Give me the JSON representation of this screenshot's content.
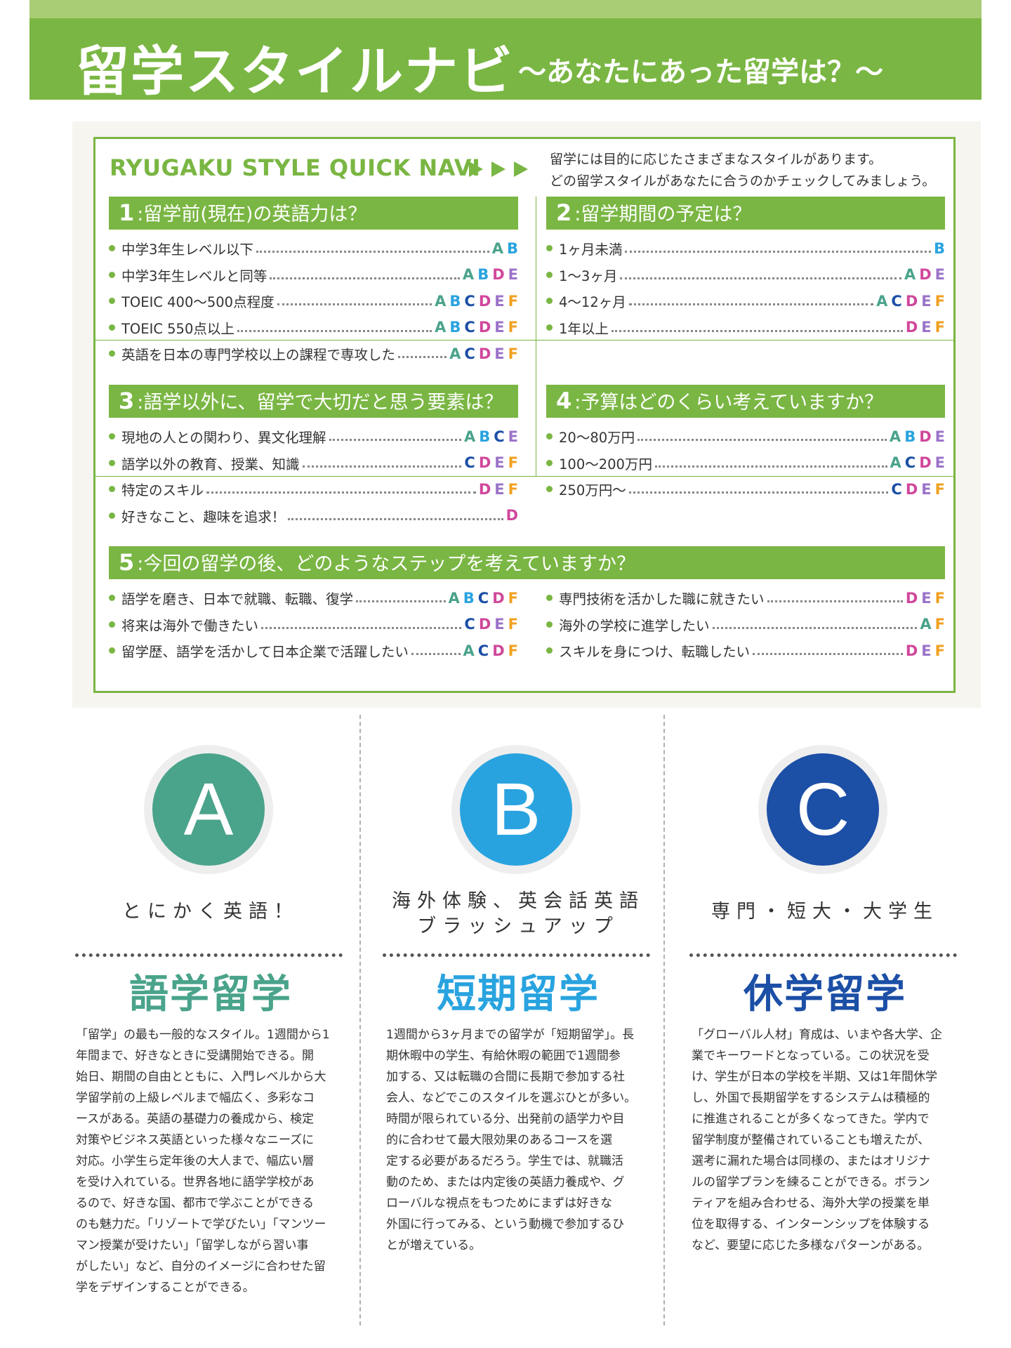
{
  "header": {
    "title": "留学スタイルナビ",
    "subtitle": "〜あなたにあった留学は？〜"
  },
  "navi": {
    "title": "RYUGAKU STYLE QUICK NAVI",
    "desc_line1": "留学には目的に応じたさまざまなスタイルがあります。",
    "desc_line2": "どの留学スタイルがあなたに合うのかチェックしてみましょう。"
  },
  "colors": {
    "brand_green": "#7ab643",
    "A": "#4aa38b",
    "B": "#29a3df",
    "C": "#1c4fa6",
    "D": "#d0479b",
    "E": "#9b73c9",
    "F": "#f0a01f"
  },
  "sections": [
    {
      "num": "1",
      "title": ":留学前(現在)の英語力は？",
      "items": [
        {
          "label": "中学3年生レベル以下",
          "letters": [
            "A",
            "B"
          ]
        },
        {
          "label": "中学3年生レベルと同等",
          "letters": [
            "A",
            "B",
            "D",
            "E"
          ]
        },
        {
          "label": "TOEIC 400〜500点程度",
          "letters": [
            "A",
            "B",
            "C",
            "D",
            "E",
            "F"
          ]
        },
        {
          "label": "TOEIC 550点以上",
          "letters": [
            "A",
            "B",
            "C",
            "D",
            "E",
            "F"
          ]
        },
        {
          "label": "英語を日本の専門学校以上の課程で専攻した",
          "letters": [
            "A",
            "C",
            "D",
            "E",
            "F"
          ]
        }
      ]
    },
    {
      "num": "2",
      "title": ":留学期間の予定は？",
      "items": [
        {
          "label": "1ヶ月未満",
          "letters": [
            "B"
          ]
        },
        {
          "label": "1〜3ヶ月",
          "letters": [
            "A",
            "D",
            "E"
          ]
        },
        {
          "label": "4〜12ヶ月",
          "letters": [
            "A",
            "C",
            "D",
            "E",
            "F"
          ]
        },
        {
          "label": "1年以上",
          "letters": [
            "D",
            "E",
            "F"
          ]
        }
      ]
    },
    {
      "num": "3",
      "title": ":語学以外に、留学で大切だと思う要素は？",
      "items": [
        {
          "label": "現地の人との関わり、異文化理解",
          "letters": [
            "A",
            "B",
            "C",
            "E"
          ]
        },
        {
          "label": "語学以外の教育、授業、知識",
          "letters": [
            "C",
            "D",
            "E",
            "F"
          ]
        },
        {
          "label": "特定のスキル",
          "letters": [
            "D",
            "E",
            "F"
          ]
        },
        {
          "label": "好きなこと、趣味を追求！",
          "letters": [
            "D"
          ]
        }
      ]
    },
    {
      "num": "4",
      "title": ":予算はどのくらい考えていますか？",
      "items": [
        {
          "label": "20〜80万円",
          "letters": [
            "A",
            "B",
            "D",
            "E"
          ]
        },
        {
          "label": "100〜200万円",
          "letters": [
            "A",
            "C",
            "D",
            "E"
          ]
        },
        {
          "label": "250万円〜",
          "letters": [
            "C",
            "D",
            "E",
            "F"
          ]
        }
      ]
    },
    {
      "num": "5",
      "title": ":今回の留学の後、どのようなステップを考えていますか？",
      "items_left": [
        {
          "label": "語学を磨き、日本で就職、転職、復学",
          "letters": [
            "A",
            "B",
            "C",
            "D",
            "F"
          ]
        },
        {
          "label": "将来は海外で働きたい",
          "letters": [
            "C",
            "D",
            "E",
            "F"
          ]
        },
        {
          "label": "留学歴、語学を活かして日本企業で活躍したい",
          "letters": [
            "A",
            "C",
            "D",
            "F"
          ]
        }
      ],
      "items_right": [
        {
          "label": "専門技術を活かした職に就きたい",
          "letters": [
            "D",
            "E",
            "F"
          ]
        },
        {
          "label": "海外の学校に進学したい",
          "letters": [
            "A",
            "F"
          ]
        },
        {
          "label": "スキルを身につけ、転職したい",
          "letters": [
            "D",
            "E",
            "F"
          ]
        }
      ]
    }
  ],
  "columns": [
    {
      "letter": "A",
      "color": "#4aa38b",
      "tagline": "とにかく英語！",
      "title": "語学留学",
      "body": [
        "「留学」の最も一般的なスタイル。1週間から1",
        "年間まで、好きなときに受講開始できる。開",
        "始日、期間の自由とともに、入門レベルから大",
        "学留学前の上級レベルまで幅広く、多彩なコ",
        "ースがある。英語の基礎力の養成から、検定",
        "対策やビジネス英語といった様々なニーズに",
        "対応。小学生ら定年後の大人まで、幅広い層",
        "を受け入れている。世界各地に語学学校があ",
        "るので、好きな国、都市で学ぶことができる",
        "のも魅力だ。「リゾートで学びたい」「マンツー",
        "マン授業が受けたい」「留学しながら習い事",
        "がしたい」など、自分のイメージに合わせた留",
        "学をデザインすることができる。"
      ]
    },
    {
      "letter": "B",
      "color": "#29a3df",
      "tagline_line1": "海外体験、英会話英語",
      "tagline_line2": "ブラッシュアップ",
      "title": "短期留学",
      "body": [
        "1週間から3ヶ月までの留学が「短期留学」。長",
        "期休暇中の学生、有給休暇の範囲で1週間参",
        "加する、又は転職の合間に長期で参加する社",
        "会人、などでこのスタイルを選ぶひとが多い。",
        "時間が限られている分、出発前の語学力や目",
        "的に合わせて最大限効果のあるコースを選",
        "定する必要があるだろう。学生では、就職活",
        "動のため、または内定後の英語力養成や、グ",
        "ローバルな視点をもつためにまずは好きな",
        "外国に行ってみる、という動機で参加するひ",
        "とが増えている。"
      ]
    },
    {
      "letter": "C",
      "color": "#1c4fa6",
      "tagline": "専門・短大・大学生",
      "title": "休学留学",
      "body": [
        "「グローバル人材」育成は、いまや各大学、企",
        "業でキーワードとなっている。この状況を受",
        "け、学生が日本の学校を半期、又は1年間休学",
        "し、外国で長期留学をするシステムは積極的",
        "に推進されることが多くなってきた。学内で",
        "留学制度が整備されていることも増えたが、",
        "選考に漏れた場合は同様の、またはオリジナ",
        "ルの留学プランを練ることができる。ボラン",
        "ティアを組み合わせる、海外大学の授業を単",
        "位を取得する、インターンシップを体験する",
        "など、要望に応じた多様なパターンがある。"
      ]
    }
  ]
}
